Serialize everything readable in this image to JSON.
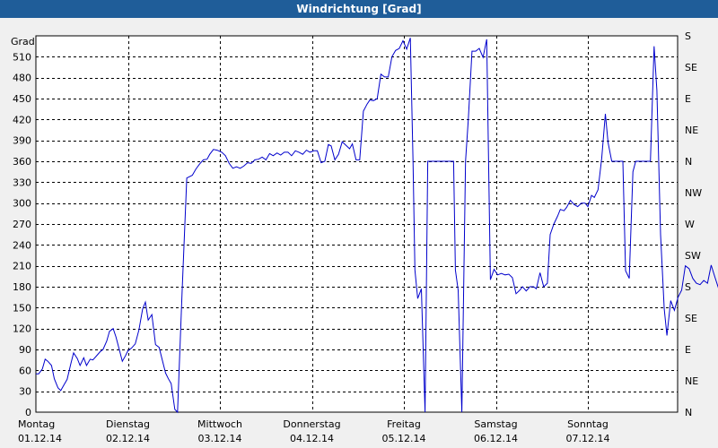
{
  "window_title": "Windrichtung [Grad]",
  "chart_data": {
    "type": "line",
    "title": "Windrichtung [Grad]",
    "ylabel": "Grad",
    "ylim": [
      0,
      540
    ],
    "yticks": [
      0,
      30,
      60,
      90,
      120,
      150,
      180,
      210,
      240,
      270,
      300,
      330,
      360,
      390,
      420,
      450,
      480,
      510
    ],
    "right_axis_labels": [
      {
        "value": 0,
        "label": "N"
      },
      {
        "value": 45,
        "label": "NE"
      },
      {
        "value": 90,
        "label": "E"
      },
      {
        "value": 135,
        "label": "SE"
      },
      {
        "value": 180,
        "label": "S"
      },
      {
        "value": 225,
        "label": "SW"
      },
      {
        "value": 270,
        "label": "W"
      },
      {
        "value": 315,
        "label": "NW"
      },
      {
        "value": 360,
        "label": "N"
      },
      {
        "value": 405,
        "label": "NE"
      },
      {
        "value": 450,
        "label": "E"
      },
      {
        "value": 495,
        "label": "SE"
      },
      {
        "value": 540,
        "label": "S"
      }
    ],
    "x_unit": "days since 01.12.14 00:00",
    "xlim": [
      0,
      7
    ],
    "xticks": [
      {
        "x": 0,
        "day": "Montag",
        "date": "01.12.14"
      },
      {
        "x": 1,
        "day": "Dienstag",
        "date": "02.12.14"
      },
      {
        "x": 2,
        "day": "Mittwoch",
        "date": "03.12.14"
      },
      {
        "x": 3,
        "day": "Donnerstag",
        "date": "04.12.14"
      },
      {
        "x": 4,
        "day": "Freitag",
        "date": "05.12.14"
      },
      {
        "x": 5,
        "day": "Samstag",
        "date": "06.12.14"
      },
      {
        "x": 6,
        "day": "Sonntag",
        "date": "07.12.14"
      }
    ],
    "grid": true,
    "series": [
      {
        "name": "Windrichtung",
        "color": "#0000cc",
        "points": [
          [
            0.0,
            55
          ],
          [
            0.03,
            55
          ],
          [
            0.07,
            62
          ],
          [
            0.1,
            76
          ],
          [
            0.13,
            73
          ],
          [
            0.17,
            67
          ],
          [
            0.2,
            48
          ],
          [
            0.24,
            35
          ],
          [
            0.27,
            31
          ],
          [
            0.3,
            38
          ],
          [
            0.34,
            47
          ],
          [
            0.38,
            70
          ],
          [
            0.41,
            85
          ],
          [
            0.45,
            77
          ],
          [
            0.48,
            67
          ],
          [
            0.52,
            78
          ],
          [
            0.55,
            67
          ],
          [
            0.59,
            76
          ],
          [
            0.62,
            75
          ],
          [
            0.66,
            81
          ],
          [
            0.7,
            87
          ],
          [
            0.73,
            90
          ],
          [
            0.77,
            102
          ],
          [
            0.8,
            116
          ],
          [
            0.84,
            120
          ],
          [
            0.87,
            108
          ],
          [
            0.91,
            88
          ],
          [
            0.94,
            73
          ],
          [
            0.97,
            80
          ],
          [
            1.0,
            88
          ],
          [
            1.04,
            92
          ],
          [
            1.08,
            98
          ],
          [
            1.12,
            118
          ],
          [
            1.16,
            148
          ],
          [
            1.19,
            158
          ],
          [
            1.22,
            132
          ],
          [
            1.26,
            140
          ],
          [
            1.3,
            97
          ],
          [
            1.34,
            93
          ],
          [
            1.37,
            77
          ],
          [
            1.41,
            56
          ],
          [
            1.44,
            48
          ],
          [
            1.47,
            41
          ],
          [
            1.51,
            4
          ],
          [
            1.54,
            0
          ],
          [
            1.59,
            176
          ],
          [
            1.64,
            336
          ],
          [
            1.7,
            340
          ],
          [
            1.74,
            349
          ],
          [
            1.78,
            356
          ],
          [
            1.82,
            362
          ],
          [
            1.86,
            363
          ],
          [
            1.89,
            370
          ],
          [
            1.93,
            377
          ],
          [
            1.97,
            376
          ],
          [
            2.02,
            373
          ],
          [
            2.06,
            368
          ],
          [
            2.1,
            357
          ],
          [
            2.14,
            350
          ],
          [
            2.18,
            352
          ],
          [
            2.22,
            350
          ],
          [
            2.26,
            353
          ],
          [
            2.3,
            358
          ],
          [
            2.34,
            357
          ],
          [
            2.38,
            362
          ],
          [
            2.42,
            363
          ],
          [
            2.46,
            366
          ],
          [
            2.5,
            362
          ],
          [
            2.54,
            371
          ],
          [
            2.58,
            368
          ],
          [
            2.62,
            372
          ],
          [
            2.66,
            369
          ],
          [
            2.7,
            373
          ],
          [
            2.74,
            373
          ],
          [
            2.78,
            368
          ],
          [
            2.82,
            375
          ],
          [
            2.86,
            373
          ],
          [
            2.9,
            370
          ],
          [
            2.94,
            376
          ],
          [
            2.98,
            373
          ],
          [
            3.02,
            375
          ],
          [
            3.06,
            375
          ],
          [
            3.1,
            358
          ],
          [
            3.14,
            360
          ],
          [
            3.18,
            384
          ],
          [
            3.21,
            382
          ],
          [
            3.25,
            362
          ],
          [
            3.29,
            370
          ],
          [
            3.33,
            388
          ],
          [
            3.37,
            383
          ],
          [
            3.41,
            378
          ],
          [
            3.44,
            385
          ],
          [
            3.48,
            362
          ],
          [
            3.52,
            362
          ],
          [
            3.56,
            432
          ],
          [
            3.6,
            442
          ],
          [
            3.63,
            448
          ],
          [
            3.67,
            447
          ],
          [
            3.71,
            450
          ],
          [
            3.75,
            485
          ],
          [
            3.79,
            481
          ],
          [
            3.83,
            481
          ],
          [
            3.87,
            510
          ],
          [
            3.91,
            519
          ],
          [
            3.95,
            522
          ],
          [
            3.99,
            533
          ],
          [
            4.03,
            521
          ],
          [
            4.07,
            537
          ],
          [
            4.1,
            360
          ],
          [
            4.12,
            204
          ],
          [
            4.15,
            163
          ],
          [
            4.19,
            177
          ],
          [
            4.23,
            0
          ],
          [
            4.26,
            360
          ],
          [
            4.32,
            360
          ],
          [
            4.38,
            360
          ],
          [
            4.44,
            360
          ],
          [
            4.5,
            360
          ],
          [
            4.54,
            360
          ],
          [
            4.56,
            204
          ],
          [
            4.59,
            175
          ],
          [
            4.63,
            0
          ],
          [
            4.67,
            360
          ],
          [
            4.7,
            420
          ],
          [
            4.74,
            518
          ],
          [
            4.78,
            518
          ],
          [
            4.82,
            522
          ],
          [
            4.86,
            509
          ],
          [
            4.9,
            535
          ],
          [
            4.94,
            190
          ],
          [
            4.98,
            205
          ],
          [
            5.02,
            197
          ],
          [
            5.06,
            199
          ],
          [
            5.1,
            197
          ],
          [
            5.14,
            198
          ],
          [
            5.18,
            193
          ],
          [
            5.22,
            170
          ],
          [
            5.26,
            175
          ],
          [
            5.29,
            180
          ],
          [
            5.33,
            174
          ],
          [
            5.37,
            180
          ],
          [
            5.41,
            180
          ],
          [
            5.44,
            177
          ],
          [
            5.48,
            200
          ],
          [
            5.52,
            180
          ],
          [
            5.56,
            185
          ],
          [
            5.59,
            255
          ],
          [
            5.63,
            270
          ],
          [
            5.67,
            281
          ],
          [
            5.7,
            291
          ],
          [
            5.74,
            289
          ],
          [
            5.77,
            294
          ],
          [
            5.81,
            304
          ],
          [
            5.85,
            298
          ],
          [
            5.89,
            295
          ],
          [
            5.93,
            300
          ],
          [
            5.97,
            300
          ],
          [
            6.0,
            295
          ],
          [
            6.04,
            311
          ],
          [
            6.07,
            308
          ],
          [
            6.11,
            319
          ],
          [
            6.15,
            364
          ],
          [
            6.19,
            428
          ],
          [
            6.22,
            387
          ],
          [
            6.26,
            360
          ],
          [
            6.3,
            360
          ],
          [
            6.34,
            360
          ],
          [
            6.38,
            360
          ],
          [
            6.41,
            203
          ],
          [
            6.45,
            192
          ],
          [
            6.49,
            345
          ],
          [
            6.52,
            360
          ],
          [
            6.56,
            360
          ],
          [
            6.6,
            360
          ],
          [
            6.64,
            360
          ],
          [
            6.68,
            360
          ],
          [
            6.72,
            525
          ],
          [
            6.75,
            462
          ],
          [
            6.79,
            255
          ],
          [
            6.83,
            148
          ],
          [
            6.86,
            110
          ],
          [
            6.9,
            160
          ],
          [
            6.94,
            146
          ],
          [
            6.98,
            165
          ],
          [
            7.02,
            175
          ],
          [
            7.06,
            210
          ],
          [
            7.1,
            206
          ],
          [
            7.14,
            192
          ],
          [
            7.18,
            185
          ],
          [
            7.22,
            183
          ],
          [
            7.26,
            189
          ],
          [
            7.3,
            185
          ],
          [
            7.34,
            211
          ],
          [
            7.38,
            194
          ],
          [
            7.42,
            178
          ],
          [
            7.46,
            164
          ],
          [
            7.5,
            210
          ],
          [
            7.54,
            240
          ],
          [
            7.58,
            250
          ],
          [
            7.62,
            249
          ],
          [
            7.66,
            252
          ]
        ]
      }
    ]
  }
}
